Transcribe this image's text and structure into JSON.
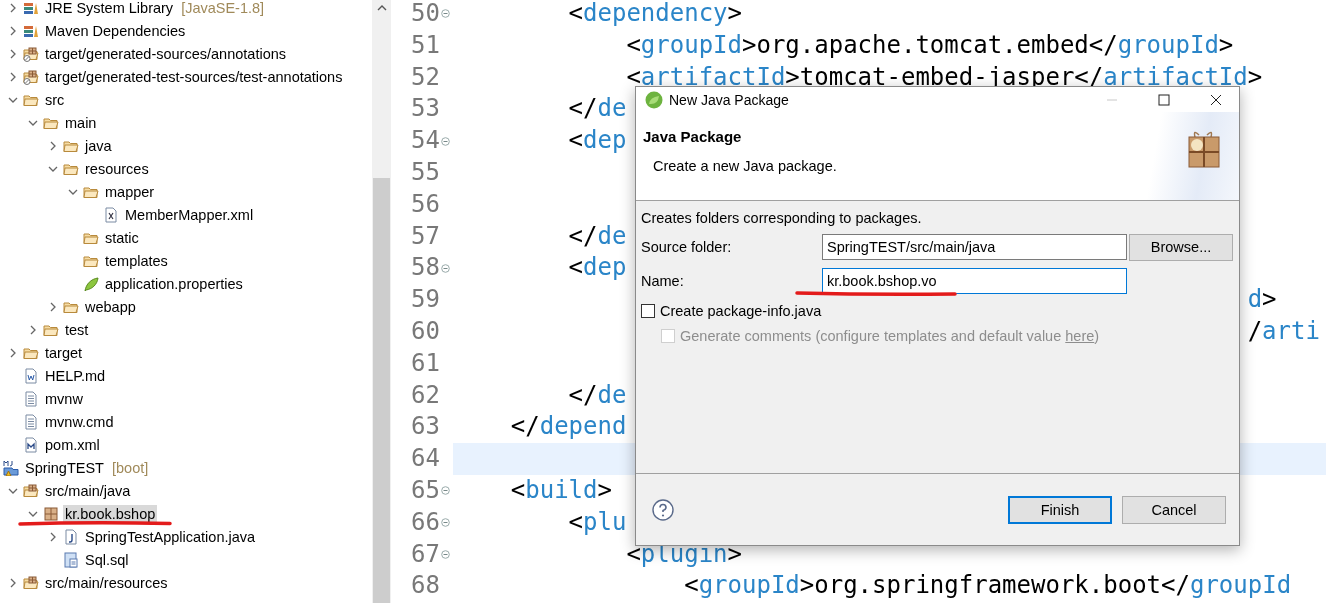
{
  "explorer": {
    "scrolled_items": [
      {
        "label": "JRE System Library",
        "decoration": "[JavaSE-1.8]",
        "kind": "library",
        "expanded": false,
        "selected": false
      },
      {
        "label": "Maven Dependencies",
        "kind": "library",
        "expanded": false,
        "selected": false
      },
      {
        "label": "target/generated-sources/annotations",
        "kind": "generated-folder",
        "expanded": false,
        "selected": false
      },
      {
        "label": "target/generated-test-sources/test-annotations",
        "kind": "generated-folder",
        "expanded": false,
        "selected": false
      },
      {
        "label": "src",
        "kind": "folder",
        "expanded": true,
        "selected": false,
        "children": [
          {
            "label": "main",
            "kind": "folder",
            "expanded": true,
            "selected": false,
            "children": [
              {
                "label": "java",
                "kind": "folder",
                "expanded": false,
                "selected": false
              },
              {
                "label": "resources",
                "kind": "folder",
                "expanded": true,
                "selected": false,
                "children": [
                  {
                    "label": "mapper",
                    "kind": "folder",
                    "expanded": true,
                    "selected": false,
                    "children": [
                      {
                        "label": "MemberMapper.xml",
                        "kind": "xml",
                        "selected": false
                      }
                    ]
                  },
                  {
                    "label": "static",
                    "kind": "folder",
                    "selected": false
                  },
                  {
                    "label": "templates",
                    "kind": "folder",
                    "selected": false
                  },
                  {
                    "label": "application.properties",
                    "kind": "properties",
                    "selected": false
                  }
                ]
              },
              {
                "label": "webapp",
                "kind": "folder",
                "expanded": false,
                "selected": false
              }
            ]
          },
          {
            "label": "test",
            "kind": "folder",
            "expanded": false,
            "selected": false
          }
        ]
      },
      {
        "label": "target",
        "kind": "folder",
        "expanded": false,
        "selected": false
      },
      {
        "label": "HELP.md",
        "kind": "word",
        "selected": false
      },
      {
        "label": "mvnw",
        "kind": "text",
        "selected": false
      },
      {
        "label": "mvnw.cmd",
        "kind": "text",
        "selected": false
      },
      {
        "label": "pom.xml",
        "kind": "maven",
        "selected": false
      }
    ],
    "projects": [
      {
        "label": "SpringTEST",
        "decoration": "[boot]",
        "kind": "project",
        "selected": false,
        "children": [
          {
            "label": "src/main/java",
            "kind": "source-folder",
            "expanded": true,
            "selected": false,
            "children": [
              {
                "label": "kr.book.bshop",
                "kind": "package",
                "expanded": true,
                "selected": true,
                "children": [
                  {
                    "label": "SpringTestApplication.java",
                    "kind": "java",
                    "expanded": false,
                    "selected": false
                  },
                  {
                    "label": "Sql.sql",
                    "kind": "sql",
                    "selected": false
                  }
                ]
              }
            ]
          },
          {
            "label": "src/main/resources",
            "kind": "source-folder",
            "expanded": false,
            "selected": false
          }
        ]
      }
    ]
  },
  "editor": {
    "lines": [
      {
        "number": "50",
        "text": "        <dependency>",
        "foldable": true,
        "current": false
      },
      {
        "number": "51",
        "text": "            <groupId>org.apache.tomcat.embed</groupId>",
        "foldable": false,
        "current": false
      },
      {
        "number": "52",
        "text": "            <artifactId>tomcat-embed-jasper</artifactId>",
        "foldable": false,
        "current": false
      },
      {
        "number": "53",
        "text": "        </de",
        "foldable": false,
        "current": false
      },
      {
        "number": "54",
        "text": "        <dep",
        "foldable": true,
        "current": false
      },
      {
        "number": "55",
        "foldable": false,
        "current": false
      },
      {
        "number": "56",
        "foldable": false,
        "current": false
      },
      {
        "number": "57",
        "text": "        </de",
        "foldable": false,
        "current": false
      },
      {
        "number": "58",
        "text": "        <dep",
        "foldable": true,
        "current": false
      },
      {
        "number": "59",
        "text": "                                                       d>",
        "foldable": false,
        "current": false
      },
      {
        "number": "60",
        "text": "                                                       /arti",
        "foldable": false,
        "current": false
      },
      {
        "number": "61",
        "foldable": false,
        "current": false
      },
      {
        "number": "62",
        "text": "        </de",
        "foldable": false,
        "current": false
      },
      {
        "number": "63",
        "text": "    </depend",
        "foldable": false,
        "current": false
      },
      {
        "number": "64",
        "foldable": false,
        "current": true
      },
      {
        "number": "65",
        "text": "    <build>",
        "foldable": true,
        "current": false
      },
      {
        "number": "66",
        "text": "        <plu",
        "foldable": true,
        "current": false
      },
      {
        "number": "67",
        "text": "            <plugin>",
        "foldable": true,
        "current": false
      },
      {
        "number": "68",
        "text": "                <groupId>org.springframework.boot</groupId",
        "foldable": false,
        "current": false
      }
    ]
  },
  "dialog": {
    "title": "New Java Package",
    "title_buttons": [
      {
        "kind": "minimize",
        "disabled": true
      },
      {
        "kind": "maximize",
        "disabled": false
      },
      {
        "kind": "close",
        "disabled": false
      }
    ],
    "heading": "Java Package",
    "description": "Create a new Java package.",
    "message": "Creates folders corresponding to packages.",
    "fields": [
      {
        "label": "Source folder:",
        "value": "SpringTEST/src/main/java",
        "focused": false,
        "button": "Browse..."
      },
      {
        "label": "Name:",
        "value": "kr.book.bshop.vo",
        "focused": true
      }
    ],
    "options": [
      {
        "label": "Create package-info.java",
        "checked": false,
        "disabled": false,
        "children": [
          {
            "label": "Generate comments (configure templates and default value ",
            "link": "here",
            "label_end": ")",
            "checked": false,
            "disabled": true
          }
        ]
      }
    ],
    "buttons": [
      {
        "label": "Finish",
        "default": true
      },
      {
        "label": "Cancel",
        "default": false
      }
    ]
  }
}
